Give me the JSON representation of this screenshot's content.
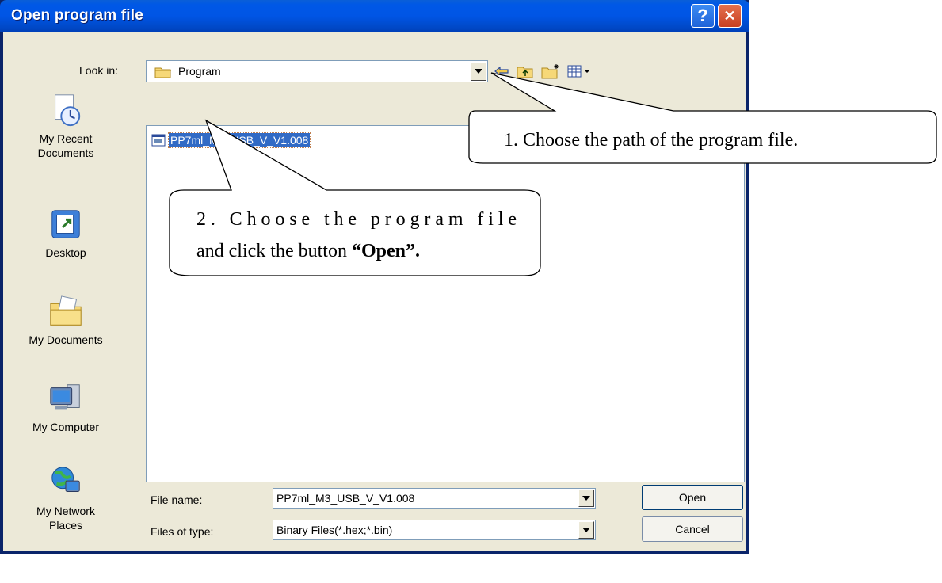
{
  "window": {
    "title": "Open program file",
    "help_glyph": "?",
    "close_glyph": "✕"
  },
  "lookin": {
    "label": "Look in:",
    "value": "Program"
  },
  "toolbar": {
    "icons": [
      "back-arrow-icon",
      "up-folder-icon",
      "new-folder-icon",
      "view-menu-icon"
    ]
  },
  "places": [
    {
      "label": "My Recent Documents",
      "line1": "My Recent",
      "line2": "Documents",
      "icon": "recent-documents-icon"
    },
    {
      "label": "Desktop",
      "line1": "Desktop",
      "line2": "",
      "icon": "desktop-icon"
    },
    {
      "label": "My Documents",
      "line1": "My Documents",
      "line2": "",
      "icon": "my-documents-icon"
    },
    {
      "label": "My Computer",
      "line1": "My Computer",
      "line2": "",
      "icon": "my-computer-icon"
    },
    {
      "label": "My Network Places",
      "line1": "My Network",
      "line2": "Places",
      "icon": "network-places-icon"
    }
  ],
  "file_list": {
    "items": [
      {
        "name": "PP7ml_M3_USB_V_V1.008",
        "selected": true,
        "icon": "hex-file-icon"
      }
    ]
  },
  "filename": {
    "label": "File name:",
    "value": "PP7ml_M3_USB_V_V1.008"
  },
  "filetype": {
    "label": "Files of type:",
    "value": "Binary Files(*.hex;*.bin)"
  },
  "buttons": {
    "open": "Open",
    "cancel": "Cancel"
  },
  "annotations": {
    "callout1": "1. Choose the path of the program file.",
    "callout2_line1": "2. Choose the program file",
    "callout2_line2_prefix": "and click the button ",
    "callout2_line2_bold": "“Open”."
  },
  "colors": {
    "titlebar": "#0055E5",
    "dialog_bg": "#ECE9D8",
    "selection": "#316AC5"
  }
}
